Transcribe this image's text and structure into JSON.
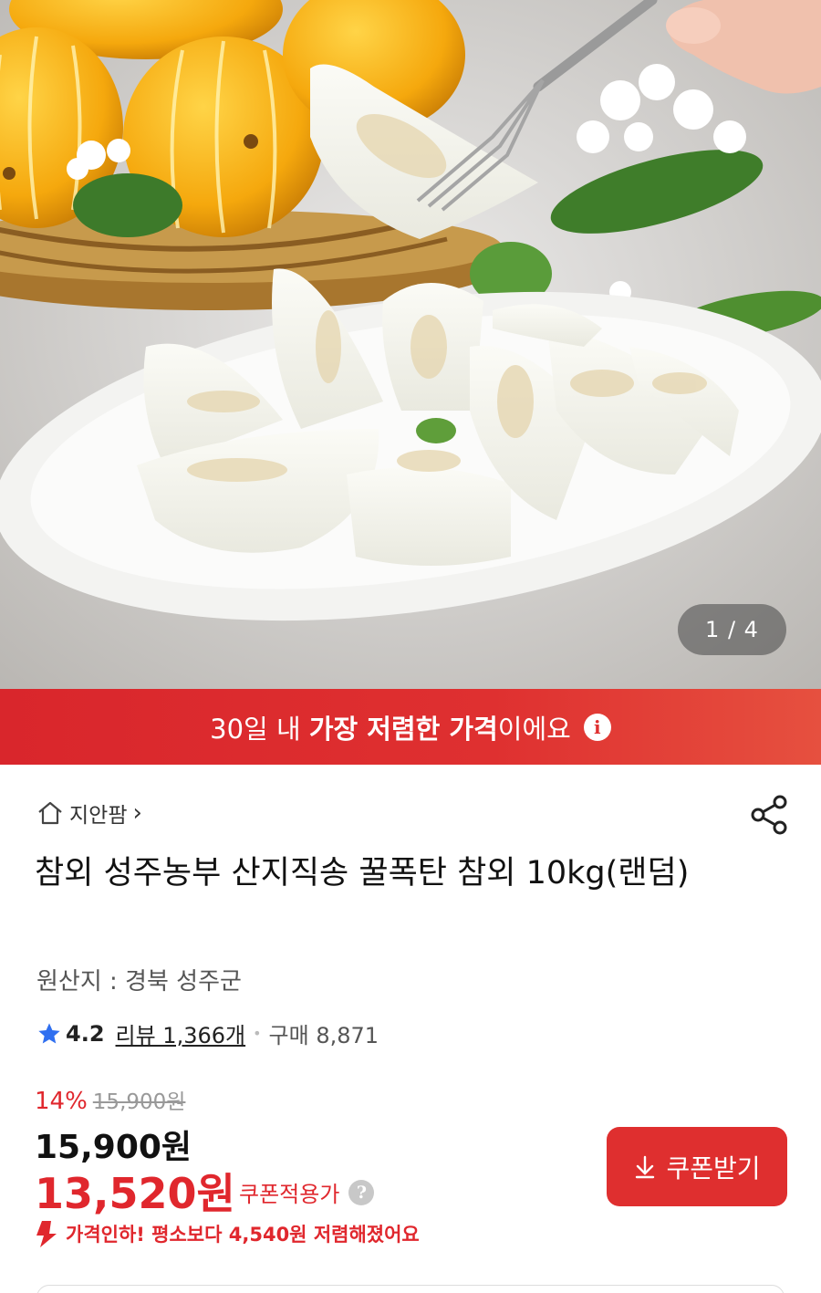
{
  "hero": {
    "image_counter": "1 / 4"
  },
  "banner": {
    "text_before": "30일 내 ",
    "text_bold": "가장 저렴한 가격",
    "text_after": "이에요",
    "info_icon": "i"
  },
  "product": {
    "store_name": "지안팜",
    "store_chevron": "›",
    "title": "참외 성주농부 산지직송 꿀폭탄 참외 10kg(랜덤)",
    "origin": "원산지 : 경북 성주군",
    "rating_score": "4.2",
    "reviews": "리뷰 1,366개",
    "sold": "구매 8,871"
  },
  "price": {
    "discount_rate": "14%",
    "original_price": "15,900원",
    "sale_price": "15,900원",
    "coupon_price": "13,520원",
    "coupon_label": "쿠폰적용가",
    "help_icon": "?",
    "drop_message": "가격인하! 평소보다 4,540원 저렴해졌어요"
  },
  "coupon_button": {
    "label": "쿠폰받기"
  },
  "icons": {
    "home": "home-icon",
    "share": "share-icon",
    "star": "star-icon",
    "download": "download-arrow-icon",
    "price_drop": "down-arrow-icon"
  },
  "colors": {
    "accent_red": "#df2f2f",
    "star_blue": "#2f6ff0"
  }
}
